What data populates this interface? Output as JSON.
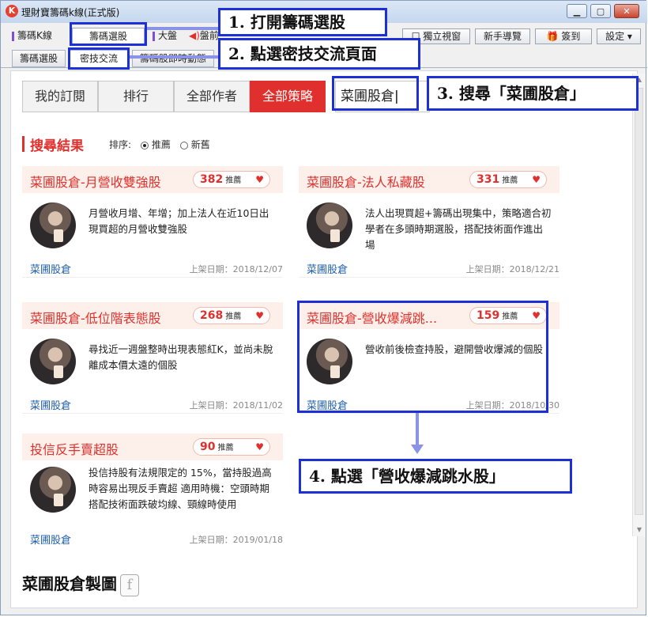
{
  "window": {
    "title": "理財寶籌碼k線(正式版)",
    "logo": "K",
    "controls": [
      "minimize-icon",
      "maximize-icon",
      "close-icon"
    ]
  },
  "top_tabs": [
    {
      "label": "籌碼K線"
    },
    {
      "label": "籌碼選股"
    },
    {
      "label": "大盤"
    },
    {
      "label": "盤前"
    }
  ],
  "top_right_buttons": [
    {
      "label": "獨立視窗"
    },
    {
      "label": "新手導覽"
    },
    {
      "label": "簽到"
    },
    {
      "label": "設定"
    }
  ],
  "sub_tabs": [
    {
      "label": "籌碼選股"
    },
    {
      "label": "密技交流"
    },
    {
      "label": "籌碼股即時動態"
    }
  ],
  "nav": {
    "buttons": [
      {
        "label": "我的訂閱"
      },
      {
        "label": "排行"
      },
      {
        "label": "全部作者"
      },
      {
        "label": "全部策略"
      }
    ],
    "search_value": "菜圃股倉"
  },
  "results": {
    "title": "搜尋結果",
    "sort_label": "排序:",
    "sort_options": [
      {
        "label": "推薦",
        "selected": true
      },
      {
        "label": "新舊",
        "selected": false
      }
    ]
  },
  "recommend_suffix": "推薦",
  "date_prefix": "上架日期：",
  "cards": [
    {
      "title": "菜圃股倉-月營收雙強股",
      "count": "382",
      "desc": "月營收月增、年增；加上法人在近10日出現買超的月營收雙強股",
      "author": "菜圃股倉",
      "date": "2018/12/07"
    },
    {
      "title": "菜圃股倉-法人私藏股",
      "count": "331",
      "desc": "法人出現買超+籌碼出現集中，策略適合初學者在多頭時期選股，搭配技術面作進出場",
      "author": "菜圃股倉",
      "date": "2018/12/21"
    },
    {
      "title": "菜圃股倉-低位階表態股",
      "count": "268",
      "desc": "尋找近一週盤整時出現表態紅K，並尚未脫離成本價太遠的個股",
      "author": "菜圃股倉",
      "date": "2018/11/02"
    },
    {
      "title": "菜圃股倉-營收爆減跳...",
      "count": "159",
      "desc": "營收前後檢查持股，避開營收爆減的個股",
      "author": "菜圃股倉",
      "date": "2018/10/30"
    },
    {
      "title": "投信反手賣超股",
      "count": "90",
      "desc": "投信持股有法規限定的 15%，當持股過高時容易出現反手賣超 適用時機：空頭時期搭配技術面跌破均線、頸線時使用",
      "author": "菜圃股倉",
      "date": "2019/01/18"
    }
  ],
  "footer": {
    "text": "菜圃股倉製圖",
    "icon": "facebook-icon"
  },
  "annotations": [
    {
      "label": "1. 打開籌碼選股"
    },
    {
      "label": "2. 點選密技交流頁面"
    },
    {
      "label": "3. 搜尋「菜圃股倉」"
    },
    {
      "label": "4. 點選「營收爆減跳水股」"
    }
  ],
  "colors": {
    "accent_red": "#e0302d",
    "annotation_blue": "#1c30d6",
    "author_blue": "#1f5fa8",
    "card_head_bg": "#fdf0ea"
  }
}
